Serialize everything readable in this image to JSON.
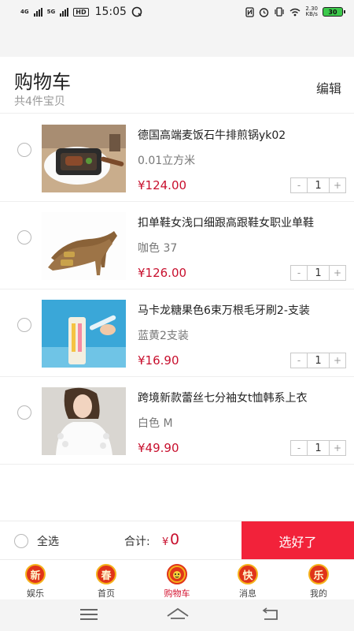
{
  "status_bar": {
    "net1": "4G",
    "net2": "5G",
    "hd": "HD",
    "time": "15:05",
    "speed_value": "2.30",
    "speed_unit": "KB/s",
    "battery": "30",
    "battery_color": "#3cc94b"
  },
  "header": {
    "title": "购物车",
    "subtitle": "共4件宝贝",
    "edit_label": "编辑"
  },
  "items": [
    {
      "name": "德国高端麦饭石牛排煎锅yk02",
      "spec": "0.01立方米",
      "price": "¥124.00",
      "quantity": "1",
      "minus": "-",
      "plus": "+"
    },
    {
      "name": "扣单鞋女浅口细跟高跟鞋女职业单鞋",
      "spec": "咖色 37",
      "price": "¥126.00",
      "quantity": "1",
      "minus": "-",
      "plus": "+"
    },
    {
      "name": "马卡龙糖果色6束万根毛牙刷2-支装",
      "spec": "蓝黄2支装",
      "price": "¥16.90",
      "quantity": "1",
      "minus": "-",
      "plus": "+"
    },
    {
      "name": "跨境新款蕾丝七分袖女t恤韩系上衣",
      "spec": "白色 M",
      "price": "¥49.90",
      "quantity": "1",
      "minus": "-",
      "plus": "+"
    }
  ],
  "checkout": {
    "select_all_label": "全选",
    "total_label": "合计:",
    "currency": "¥",
    "total_amount": "0",
    "submit_label": "选好了",
    "accent_color": "#f2223a"
  },
  "tabs": [
    {
      "icon_char": "新",
      "label": "娱乐",
      "icon": "xin-badge-icon"
    },
    {
      "icon_char": "春",
      "label": "首页",
      "icon": "chun-badge-icon"
    },
    {
      "icon_char": "",
      "label": "购物车",
      "icon": "cart-lion-icon",
      "active": true
    },
    {
      "icon_char": "快",
      "label": "消息",
      "icon": "kuai-badge-icon"
    },
    {
      "icon_char": "乐",
      "label": "我的",
      "icon": "le-badge-icon"
    }
  ]
}
